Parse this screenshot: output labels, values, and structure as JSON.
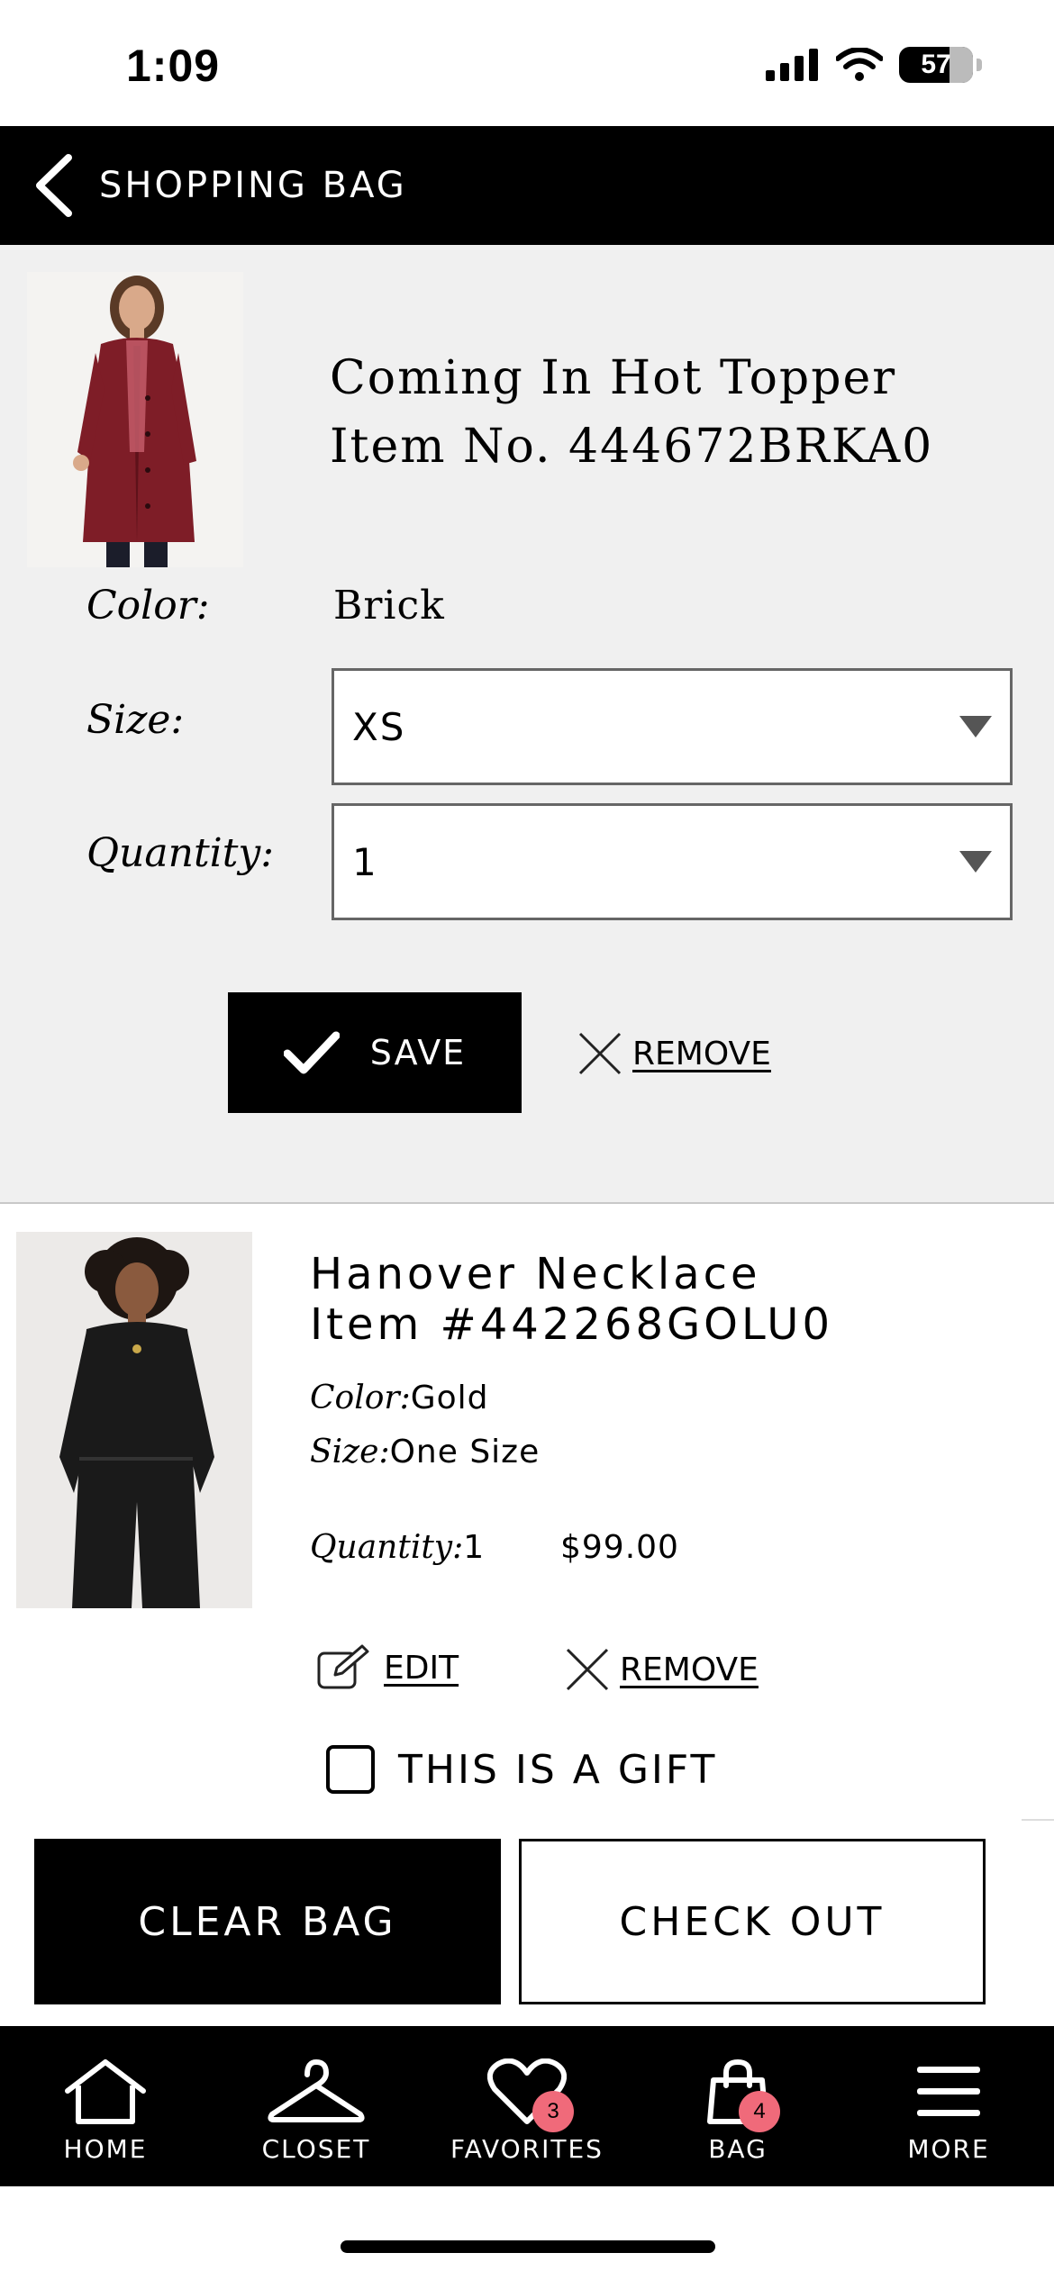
{
  "status_bar": {
    "time": "1:09",
    "battery": "57"
  },
  "header": {
    "title": "SHOPPING BAG"
  },
  "edit_item": {
    "name": "Coming In Hot Topper",
    "item_no": "Item No. 444672BRKA0",
    "color_label": "Color:",
    "color_value": "Brick",
    "size_label": "Size:",
    "size_value": "XS",
    "quantity_label": "Quantity:",
    "quantity_value": "1",
    "save_label": "SAVE",
    "remove_label": "REMOVE",
    "image_color": "#7e1d27"
  },
  "item2": {
    "name": "Hanover Necklace",
    "item_no": "Item #442268GOLU0",
    "color_label": "Color:",
    "color_value": "Gold",
    "size_label": "Size:",
    "size_value": "One Size",
    "quantity_label": "Quantity:",
    "quantity_value": "1",
    "price": "$99.00",
    "edit_label": "EDIT",
    "remove_label": "REMOVE"
  },
  "gift": {
    "label": "THIS IS A GIFT",
    "checked": false
  },
  "actions": {
    "clear_label": "CLEAR BAG",
    "checkout_label": "CHECK OUT"
  },
  "tabs": [
    {
      "label": "HOME",
      "icon": "home-icon"
    },
    {
      "label": "CLOSET",
      "icon": "hanger-icon"
    },
    {
      "label": "FAVORITES",
      "icon": "heart-icon",
      "badge": "3"
    },
    {
      "label": "BAG",
      "icon": "bag-icon",
      "badge": "4"
    },
    {
      "label": "MORE",
      "icon": "menu-icon"
    }
  ],
  "colors": {
    "accent_black": "#000000",
    "badge_pink": "#f06a7a",
    "panel_gray": "#f0f0f0"
  }
}
